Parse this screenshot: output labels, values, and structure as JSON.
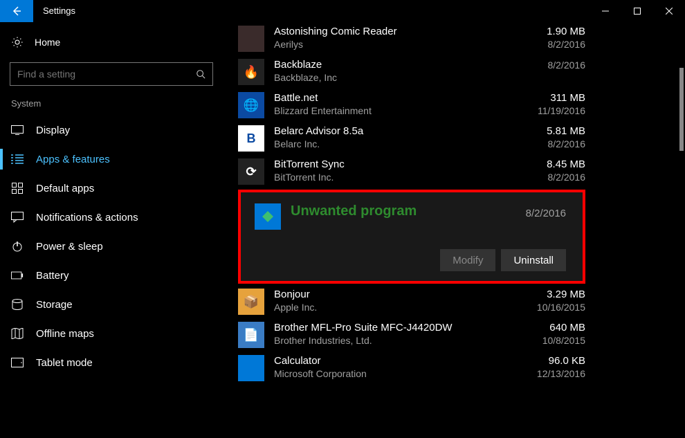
{
  "window": {
    "title": "Settings"
  },
  "home_label": "Home",
  "search": {
    "placeholder": "Find a setting"
  },
  "group_label": "System",
  "nav": [
    {
      "label": "Display"
    },
    {
      "label": "Apps & features"
    },
    {
      "label": "Default apps"
    },
    {
      "label": "Notifications & actions"
    },
    {
      "label": "Power & sleep"
    },
    {
      "label": "Battery"
    },
    {
      "label": "Storage"
    },
    {
      "label": "Offline maps"
    },
    {
      "label": "Tablet mode"
    }
  ],
  "apps": {
    "above": [
      {
        "name": "Astonishing Comic Reader",
        "publisher": "Aerilys",
        "size": "1.90 MB",
        "date": "8/2/2016",
        "icon_bg": "#3a2b2b",
        "icon_letter": ""
      },
      {
        "name": "Backblaze",
        "publisher": "Backblaze, Inc",
        "size": "",
        "date": "8/2/2016",
        "icon_bg": "#222",
        "icon_emoji": "🔥"
      },
      {
        "name": "Battle.net",
        "publisher": "Blizzard Entertainment",
        "size": "311 MB",
        "date": "11/19/2016",
        "icon_bg": "#0b4aa2",
        "icon_emoji": "🌐"
      },
      {
        "name": "Belarc Advisor 8.5a",
        "publisher": "Belarc Inc.",
        "size": "5.81 MB",
        "date": "8/2/2016",
        "icon_bg": "#fff",
        "icon_letter": "B",
        "icon_color": "#0b4aa2"
      },
      {
        "name": "BitTorrent Sync",
        "publisher": "BitTorrent Inc.",
        "size": "8.45 MB",
        "date": "8/2/2016",
        "icon_bg": "#222",
        "icon_emoji": "⟳"
      }
    ],
    "selected": {
      "name": "Unwanted program",
      "date": "8/2/2016",
      "modify_label": "Modify",
      "uninstall_label": "Uninstall"
    },
    "below": [
      {
        "name": "Bonjour",
        "publisher": "Apple Inc.",
        "size": "3.29 MB",
        "date": "10/16/2015",
        "icon_bg": "#e6a23c",
        "icon_emoji": "📦"
      },
      {
        "name": "Brother MFL-Pro Suite MFC-J4420DW",
        "publisher": "Brother Industries, Ltd.",
        "size": "640 MB",
        "date": "10/8/2015",
        "icon_bg": "#3a7cc4",
        "icon_emoji": "📄"
      },
      {
        "name": "Calculator",
        "publisher": "Microsoft Corporation",
        "size": "96.0 KB",
        "date": "12/13/2016",
        "icon_bg": "#0078d7",
        "icon_emoji": ""
      }
    ]
  }
}
